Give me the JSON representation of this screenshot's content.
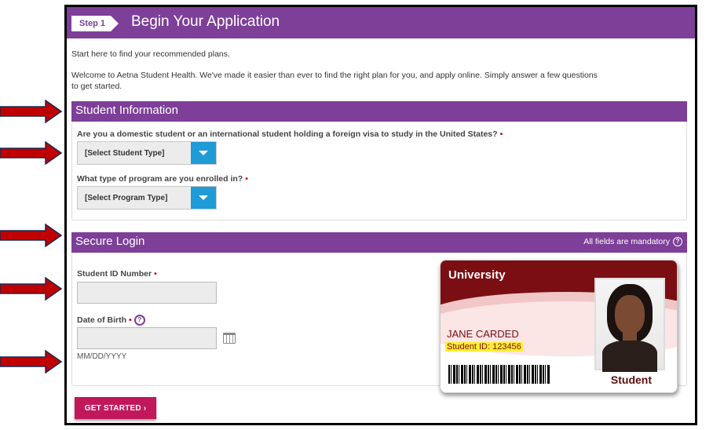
{
  "header": {
    "step_label": "Step 1",
    "title": "Begin Your Application"
  },
  "intro": {
    "line1": "Start here to find your recommended plans.",
    "line2": "Welcome to Aetna Student Health. We've made it easier than ever to find the right plan for you, and apply online. Simply answer a few questions",
    "line3": "to get started."
  },
  "student_info": {
    "title": "Student Information",
    "question1": "Are you a domestic student or an international student holding a foreign visa to study in the United States?",
    "select1_value": "[Select Student Type]",
    "question2": "What type of program are you enrolled in?",
    "select2_value": "[Select Program Type]",
    "required_marker": "•"
  },
  "secure_login": {
    "title": "Secure Login",
    "note": "All fields are mandatory",
    "student_id_label": "Student ID Number",
    "dob_label": "Date of Birth",
    "dob_hint": "MM/DD/YYYY",
    "help_glyph": "?"
  },
  "id_card": {
    "university": "University",
    "name": "JANE CARDED",
    "student_id": "Student ID: 123456",
    "role": "Student"
  },
  "actions": {
    "get_started": "GET STARTED  ›"
  },
  "colors": {
    "brand_purple": "#7d3f98",
    "select_button_blue": "#1f9bd7",
    "cta_magenta": "#c2185b",
    "arrow_red": "#c00000",
    "card_maroon": "#7b0e12"
  }
}
